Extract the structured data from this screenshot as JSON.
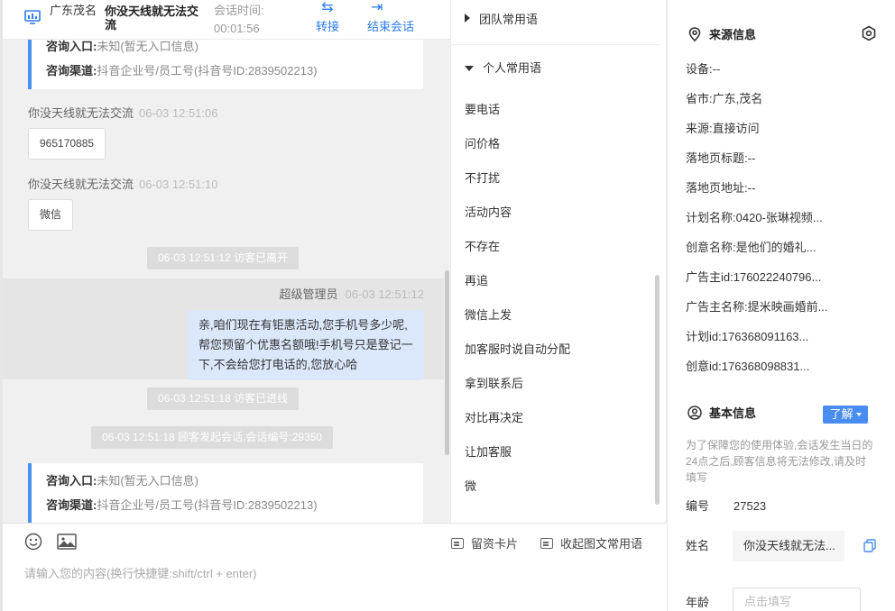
{
  "header": {
    "region": "广东茂名",
    "visitor_name": "你没天线就无法交流",
    "session_time_label": "会话时间:",
    "session_time": "00:01:56",
    "transfer_label": "转接",
    "end_session_label": "结束会话"
  },
  "chat": {
    "card_top": {
      "entry_label": "咨询入口:",
      "entry_value": "未知(暂无入口信息)",
      "channel_label": "咨询渠道:",
      "channel_value": "抖音企业号/员工号(抖音号ID:2839502213)"
    },
    "messages_in": [
      {
        "sender": "你没天线就无法交流",
        "time": "06-03 12:51:06",
        "text": "965170885"
      },
      {
        "sender": "你没天线就无法交流",
        "time": "06-03 12:51:10",
        "text": "微信"
      }
    ],
    "system_notes": [
      "06-03 12:51:12 访客已离开",
      "06-03 12:51:18 访客已进线",
      "06-03 12:51:18 顾客发起会话,会话编号:29350"
    ],
    "message_out": {
      "sender": "超级管理员",
      "time": "06-03 12:51:12",
      "text": "亲,咱们现在有钜惠活动,您手机号多少呢,帮您预留个优惠名额哦!手机号只是登记一下,不会给您打电话的,您放心哈"
    },
    "card_bottom": {
      "entry_label": "咨询入口:",
      "entry_value": "未知(暂无入口信息)",
      "channel_label": "咨询渠道:",
      "channel_value": "抖音企业号/员工号(抖音号ID:2839502213)"
    }
  },
  "input": {
    "placeholder": "请输入您的内容(换行快捷键:shift/ctrl + enter)",
    "card_label": "留资卡片",
    "collapse_label": "收起图文常用语"
  },
  "quick_replies": {
    "team_group": "团队常用语",
    "personal_group": "个人常用语",
    "items": [
      "要电话",
      "问价格",
      "不打扰",
      "活动内容",
      "不存在",
      "再追",
      "微信上发",
      "加客服时说自动分配",
      "拿到联系后",
      "对比再决定",
      "让加客服",
      "微"
    ]
  },
  "source_info": {
    "title": "来源信息",
    "fields": [
      {
        "label": "设备:",
        "value": "--"
      },
      {
        "label": "省市:",
        "value": "广东,茂名"
      },
      {
        "label": "来源:",
        "value": "直接访问"
      },
      {
        "label": "落地页标题:",
        "value": "--"
      },
      {
        "label": "落地页地址:",
        "value": "--"
      },
      {
        "label": "计划名称:",
        "value": "0420-张琳视频..."
      },
      {
        "label": "创意名称:",
        "value": "是他们的婚礼..."
      },
      {
        "label": "广告主id:",
        "value": "176022240796..."
      },
      {
        "label": "广告主名称:",
        "value": "提米映画婚前..."
      },
      {
        "label": "计划id:",
        "value": "176368091163..."
      },
      {
        "label": "创意id:",
        "value": "176368098831..."
      }
    ]
  },
  "basic_info": {
    "title": "基本信息",
    "learn_more": "了解",
    "notice": "为了保障您的使用体验,会话发生当日的24点之后,顾客信息将无法修改,请及时填写",
    "id_label": "编号",
    "id_value": "27523",
    "name_label": "姓名",
    "name_value": "你没天线就无法...",
    "age_label": "年龄",
    "age_placeholder": "点击填写"
  }
}
